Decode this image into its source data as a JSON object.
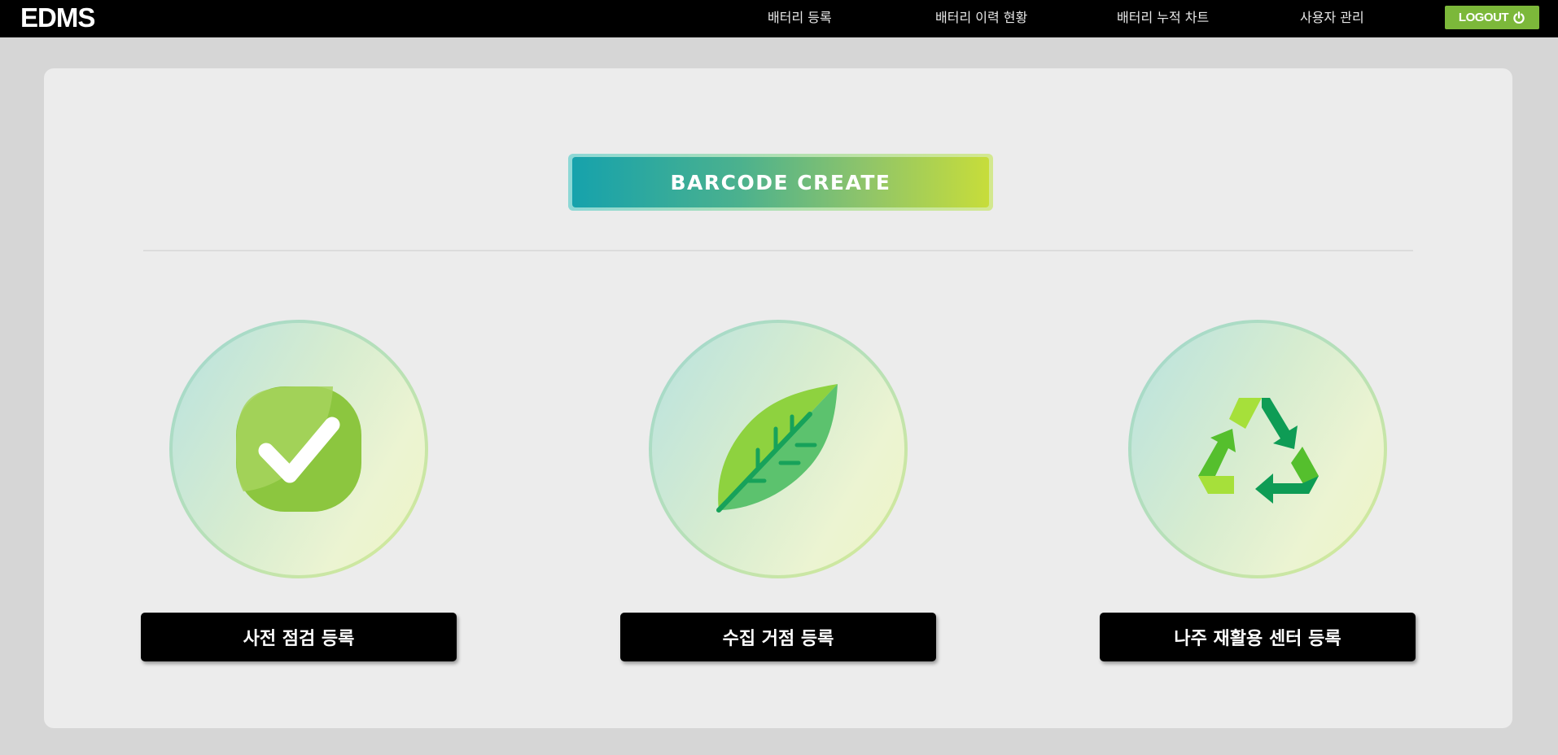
{
  "header": {
    "logo": "EDMS",
    "nav": [
      {
        "label": "배터리 등록"
      },
      {
        "label": "배터리 이력 현황"
      },
      {
        "label": "배터리 누적 차트"
      },
      {
        "label": "사용자 관리"
      }
    ],
    "logout_label": "LOGOUT",
    "logout_icon": "power-icon"
  },
  "main": {
    "barcode_label": "BARCODE CREATE",
    "cards": [
      {
        "icon": "check-icon",
        "label": "사전 점검 등록"
      },
      {
        "icon": "leaf-icon",
        "label": "수집 거점 등록"
      },
      {
        "icon": "recycle-icon",
        "label": "나주 재활용 센터 등록"
      }
    ]
  },
  "colors": {
    "nav_bg": "#000000",
    "logout_bg": "#7cb83a",
    "page_bg": "#d6d6d6",
    "panel_bg": "#ececec",
    "barcode_gradient_start": "#16a2ac",
    "barcode_gradient_end": "#c7dd3a",
    "card_button_bg": "#000000"
  }
}
